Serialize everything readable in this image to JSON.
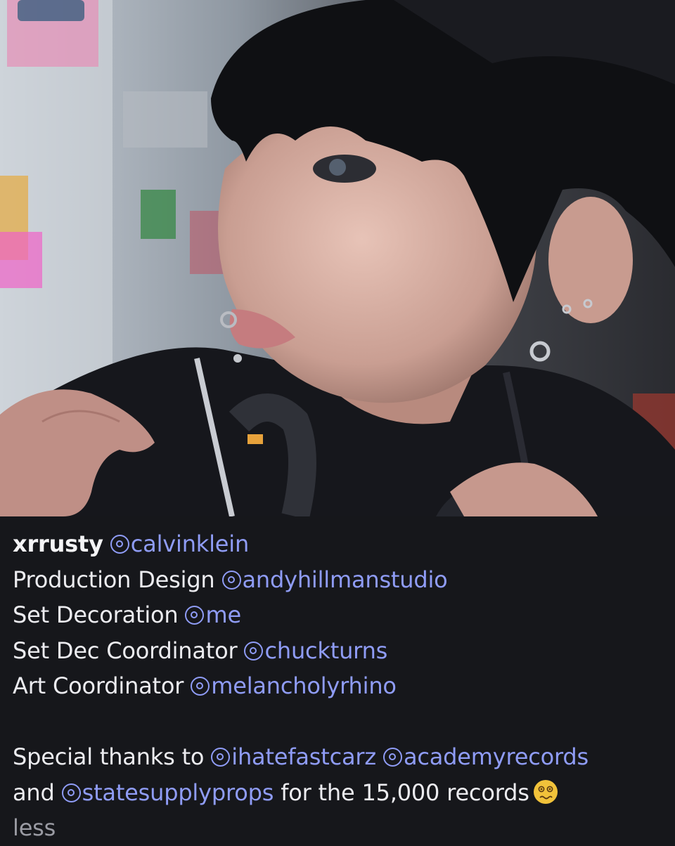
{
  "photo": {
    "subject": "person-with-piercings-holding-headphones"
  },
  "caption": {
    "username": "xrrusty",
    "credits": [
      {
        "role": "",
        "handle": "calvinklein"
      },
      {
        "role": "Production Design",
        "handle": "andyhillmanstudio"
      },
      {
        "role": "Set Decoration",
        "handle": "me"
      },
      {
        "role": "Set Dec Coordinator",
        "handle": "chuckturns"
      },
      {
        "role": "Art Coordinator",
        "handle": "melancholyrhino"
      }
    ],
    "thanks": {
      "prefix": "Special thanks to",
      "handle1": "ihatefastcarz",
      "handle2": "academyrecords",
      "and": "and",
      "handle3": "statesupplyprops",
      "suffix": "for the 15,000 records",
      "emoji": "woozy-face-emoji"
    },
    "less_label": "less"
  },
  "colors": {
    "background": "#16171b",
    "text": "#ececf0",
    "mention": "#8f9cf6",
    "muted": "#9a9ba3"
  }
}
